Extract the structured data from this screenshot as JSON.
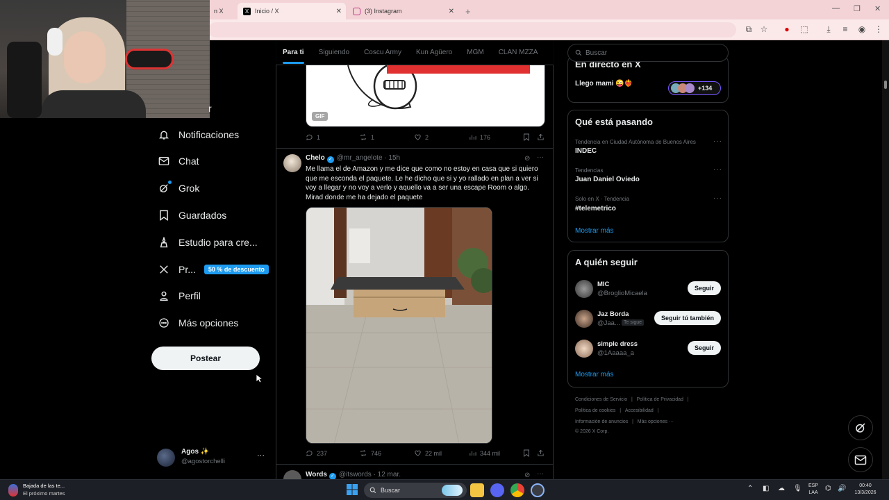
{
  "browser": {
    "tabs": [
      {
        "label": "Inicio / X",
        "active": true
      },
      {
        "label": "(3) Instagram",
        "active": false
      }
    ],
    "partial_tab": "n X",
    "new_tab": "+"
  },
  "feed_tabs": [
    "Para ti",
    "Siguiendo",
    "Coscu Army",
    "Kun Agüero",
    "MGM",
    "CLAN MZZA"
  ],
  "nav": {
    "partial_label": "r",
    "items": [
      {
        "label": "Notificaciones",
        "icon": "bell-icon"
      },
      {
        "label": "Chat",
        "icon": "mail-icon"
      },
      {
        "label": "Grok",
        "icon": "grok-icon"
      },
      {
        "label": "Guardados",
        "icon": "bookmark-icon"
      },
      {
        "label": "Estudio para cre...",
        "icon": "studio-icon"
      },
      {
        "label": "Pr...",
        "icon": "x-logo-icon",
        "badge": "50 % de descuento"
      },
      {
        "label": "Perfil",
        "icon": "person-icon"
      },
      {
        "label": "Más opciones",
        "icon": "more-circle-icon"
      }
    ],
    "post_button": "Postear",
    "account": {
      "name": "Agos ✨",
      "handle": "@agostorchelli",
      "more": "···"
    }
  },
  "tweets": [
    {
      "gif_label": "GIF",
      "replies": "1",
      "reposts": "1",
      "likes": "2",
      "views": "176"
    },
    {
      "name": "Chelo",
      "handle": "@mr_angelote",
      "time": "· 15h",
      "more": "···",
      "text": "Me llama el de Amazon y me dice que como no estoy en casa que si quiero que me esconda el paquete. Le he dicho que si y yo rallado en plan a ver si voy a llegar y no voy a verlo y aquello va a ser una escape Room o algo. Mirad donde me ha dejado el paquete",
      "replies": "237",
      "reposts": "746",
      "likes": "22 mil",
      "views": "344 mil"
    },
    {
      "name": "Words",
      "handle": "@itswords",
      "time": "· 12 mar.",
      "more": "···"
    }
  ],
  "right": {
    "search_placeholder": "Buscar",
    "live": {
      "title": "En directo en X",
      "host": "Llego mami 😜❤️‍🔥",
      "count": "+134"
    },
    "trends": {
      "title": "Qué está pasando",
      "items": [
        {
          "meta": "Tendencia en Ciudad Autónoma de Buenos Aires",
          "name": "INDEC"
        },
        {
          "meta": "Tendencias",
          "name": "Juan Daniel Oviedo"
        },
        {
          "meta": "Solo en X · Tendencia",
          "name": "#telemetrico"
        }
      ],
      "more": "Mostrar más"
    },
    "who_to_follow": {
      "title": "A quién seguir",
      "items": [
        {
          "name": "MIC",
          "handle": "@BroglioMicaela",
          "button": "Seguir"
        },
        {
          "name": "Jaz Borda",
          "handle": "@Jaa...",
          "badge": "Te sigue",
          "button": "Seguir tú también"
        },
        {
          "name": "simple dress",
          "handle": "@1Aaaaa_a",
          "button": "Seguir"
        }
      ],
      "more": "Mostrar más"
    },
    "footer": {
      "line1": [
        "Condiciones de Servicio",
        "|",
        "Política de Privacidad",
        "|"
      ],
      "line2": [
        "Política de cookies",
        "|",
        "Accesibilidad",
        "|"
      ],
      "line3": [
        "Información de anuncios",
        "|",
        "Más opciones ···"
      ],
      "copyright": "© 2026 X Corp."
    }
  },
  "taskbar": {
    "notification_title": "Bajada de las te...",
    "notification_sub": "El próximo martes",
    "search": "Buscar",
    "lang_top": "ESP",
    "lang_bottom": "LAA",
    "time": "00:40",
    "date": "13/3/2026"
  },
  "colors": {
    "accent": "#1d9bf0",
    "background": "#000000",
    "tab_bar": "#f3d3d6"
  }
}
